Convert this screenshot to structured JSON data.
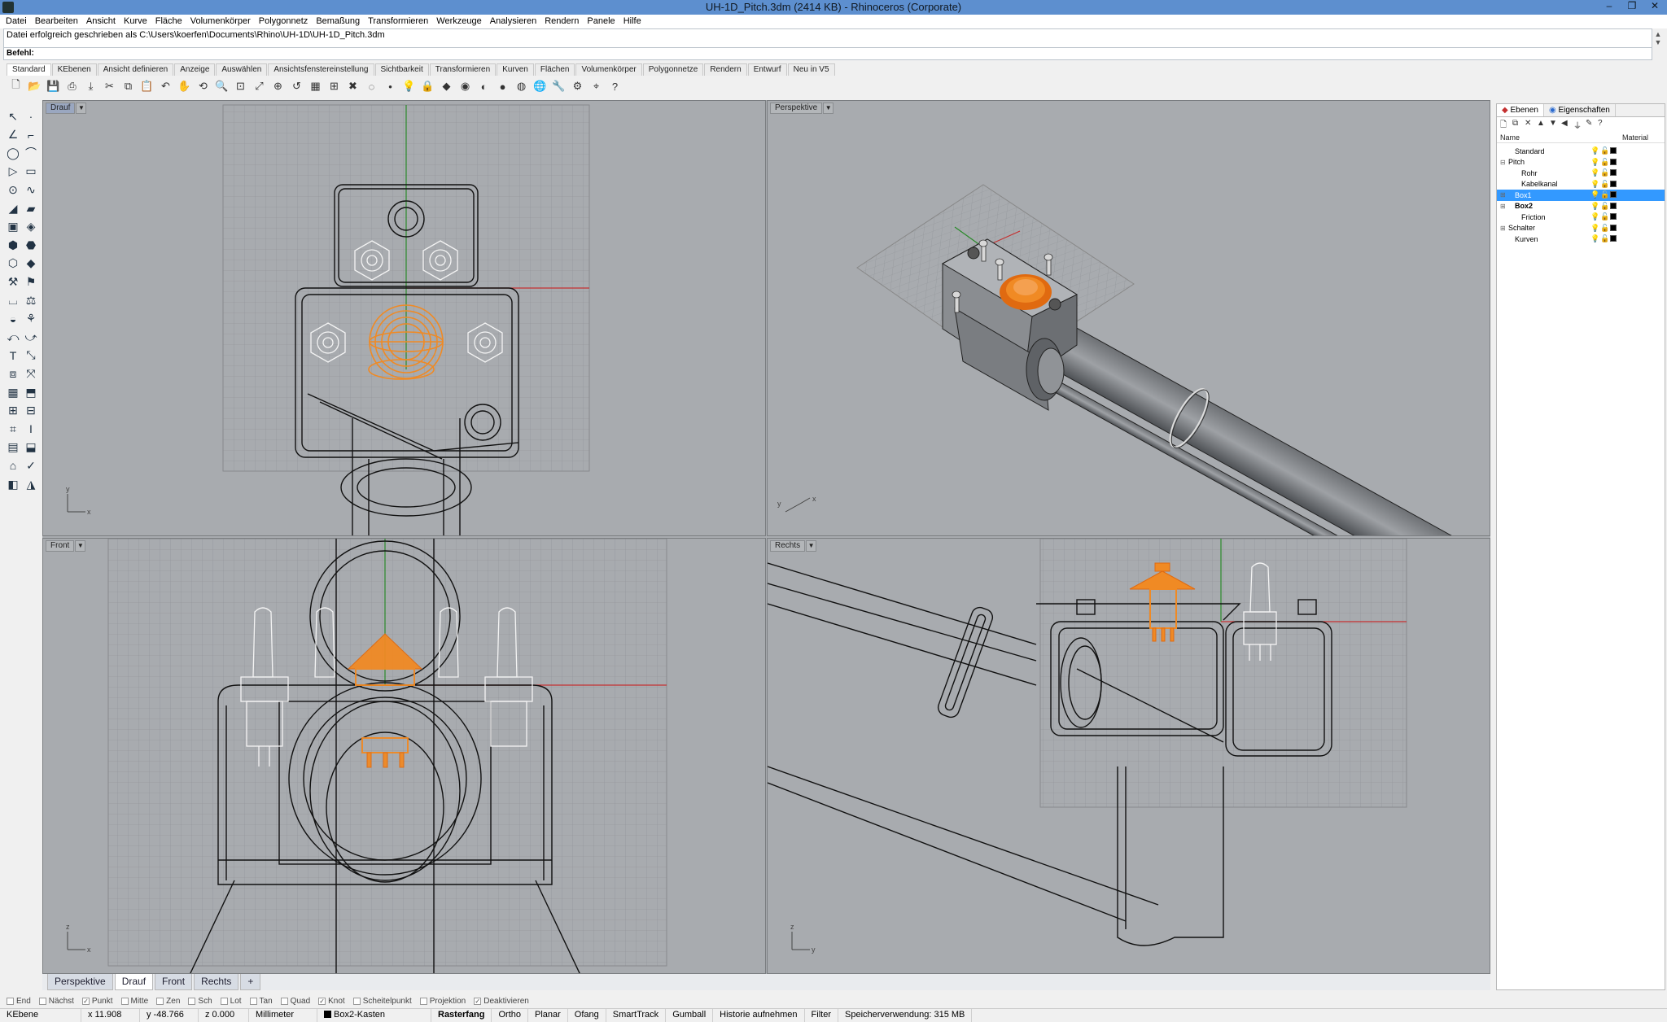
{
  "window": {
    "title": "UH-1D_Pitch.3dm (2414 KB) - Rhinoceros (Corporate)",
    "minimize": "–",
    "maximize": "❐",
    "close": "✕"
  },
  "menu": [
    "Datei",
    "Bearbeiten",
    "Ansicht",
    "Kurve",
    "Fläche",
    "Volumenkörper",
    "Polygonnetz",
    "Bemaßung",
    "Transformieren",
    "Werkzeuge",
    "Analysieren",
    "Rendern",
    "Panele",
    "Hilfe"
  ],
  "command": {
    "history": "Datei erfolgreich geschrieben als C:\\Users\\koerfen\\Documents\\Rhino\\UH-1D\\UH-1D_Pitch.3dm",
    "prompt": "Befehl:"
  },
  "toolbar_tabs": [
    "Standard",
    "KEbenen",
    "Ansicht definieren",
    "Anzeige",
    "Auswählen",
    "Ansichtsfenstereinstellung",
    "Sichtbarkeit",
    "Transformieren",
    "Kurven",
    "Flächen",
    "Volumenkörper",
    "Polygonnetze",
    "Rendern",
    "Entwurf",
    "Neu in V5"
  ],
  "viewports": {
    "top": "Drauf",
    "perspective": "Perspektive",
    "front": "Front",
    "right": "Rechts"
  },
  "viewport_tabs": [
    "Perspektive",
    "Drauf",
    "Front",
    "Rechts",
    "+"
  ],
  "osnaps": [
    {
      "label": "End",
      "checked": false
    },
    {
      "label": "Nächst",
      "checked": false
    },
    {
      "label": "Punkt",
      "checked": true
    },
    {
      "label": "Mitte",
      "checked": false
    },
    {
      "label": "Zen",
      "checked": false
    },
    {
      "label": "Sch",
      "checked": false
    },
    {
      "label": "Lot",
      "checked": false
    },
    {
      "label": "Tan",
      "checked": false
    },
    {
      "label": "Quad",
      "checked": false
    },
    {
      "label": "Knot",
      "checked": true
    },
    {
      "label": "Scheitelpunkt",
      "checked": false
    },
    {
      "label": "Projektion",
      "checked": false
    },
    {
      "label": "Deaktivieren",
      "checked": true
    }
  ],
  "status": {
    "cplane": "KEbene",
    "x": "x 11.908",
    "y": "y -48.766",
    "z": "z 0.000",
    "units": "Millimeter",
    "layer": "Box2-Kasten",
    "modes": [
      "Rasterfang",
      "Ortho",
      "Planar",
      "Ofang",
      "SmartTrack",
      "Gumball",
      "Historie aufnehmen",
      "Filter"
    ],
    "memory": "Speicherverwendung: 315 MB"
  },
  "layers_panel": {
    "tabs": [
      "Ebenen",
      "Eigenschaften"
    ],
    "columns": [
      "Name",
      "Material"
    ],
    "layers": [
      {
        "name": "Standard",
        "indent": 1,
        "expander": "",
        "selected": false,
        "bold": false
      },
      {
        "name": "Pitch",
        "indent": 0,
        "expander": "⊟",
        "selected": false,
        "bold": false
      },
      {
        "name": "Rohr",
        "indent": 2,
        "expander": "",
        "selected": false,
        "bold": false
      },
      {
        "name": "Kabelkanal",
        "indent": 2,
        "expander": "",
        "selected": false,
        "bold": false
      },
      {
        "name": "Box1",
        "indent": 1,
        "expander": "⊞",
        "selected": true,
        "bold": false
      },
      {
        "name": "Box2",
        "indent": 1,
        "expander": "⊞",
        "selected": false,
        "bold": true
      },
      {
        "name": "Friction",
        "indent": 2,
        "expander": "",
        "selected": false,
        "bold": false
      },
      {
        "name": "Schalter",
        "indent": 0,
        "expander": "⊞",
        "selected": false,
        "bold": false
      },
      {
        "name": "Kurven",
        "indent": 1,
        "expander": "",
        "selected": false,
        "bold": false
      }
    ]
  },
  "colors": {
    "selection": "#f08a24",
    "axis_x": "#c43030",
    "axis_y": "#2a8a2a",
    "viewport_bg": "#a8abaf",
    "grid": "#8e9196"
  }
}
